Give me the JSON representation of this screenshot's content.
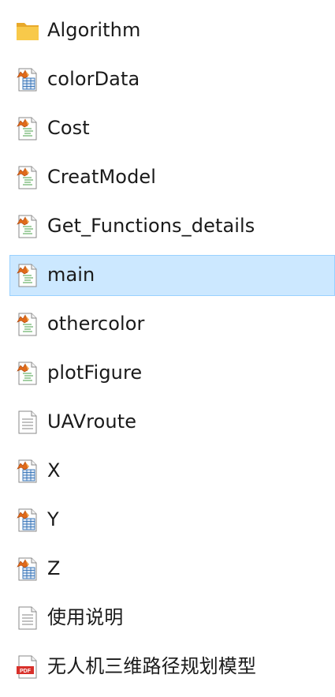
{
  "files": [
    {
      "name": "Algorithm",
      "icon": "folder-icon",
      "selected": false
    },
    {
      "name": "colorData",
      "icon": "matlab-data-icon",
      "selected": false
    },
    {
      "name": "Cost",
      "icon": "matlab-file-icon",
      "selected": false
    },
    {
      "name": "CreatModel",
      "icon": "matlab-file-icon",
      "selected": false
    },
    {
      "name": "Get_Functions_details",
      "icon": "matlab-file-icon",
      "selected": false
    },
    {
      "name": "main",
      "icon": "matlab-file-icon",
      "selected": true
    },
    {
      "name": "othercolor",
      "icon": "matlab-file-icon",
      "selected": false
    },
    {
      "name": "plotFigure",
      "icon": "matlab-file-icon",
      "selected": false
    },
    {
      "name": "UAVroute",
      "icon": "text-file-icon",
      "selected": false
    },
    {
      "name": "X",
      "icon": "matlab-data-icon",
      "selected": false
    },
    {
      "name": "Y",
      "icon": "matlab-data-icon",
      "selected": false
    },
    {
      "name": "Z",
      "icon": "matlab-data-icon",
      "selected": false
    },
    {
      "name": "使用说明",
      "icon": "text-file-icon",
      "selected": false
    },
    {
      "name": "无人机三维路径规划模型",
      "icon": "pdf-file-icon",
      "selected": false
    }
  ],
  "colors": {
    "selection_fill": "#cce8ff",
    "selection_border": "#99d1ff",
    "folder": "#f8c94a",
    "matlab_orange": "#e16a1a",
    "matlab_blue": "#2f6fb5",
    "pdf_red": "#d8302a"
  }
}
